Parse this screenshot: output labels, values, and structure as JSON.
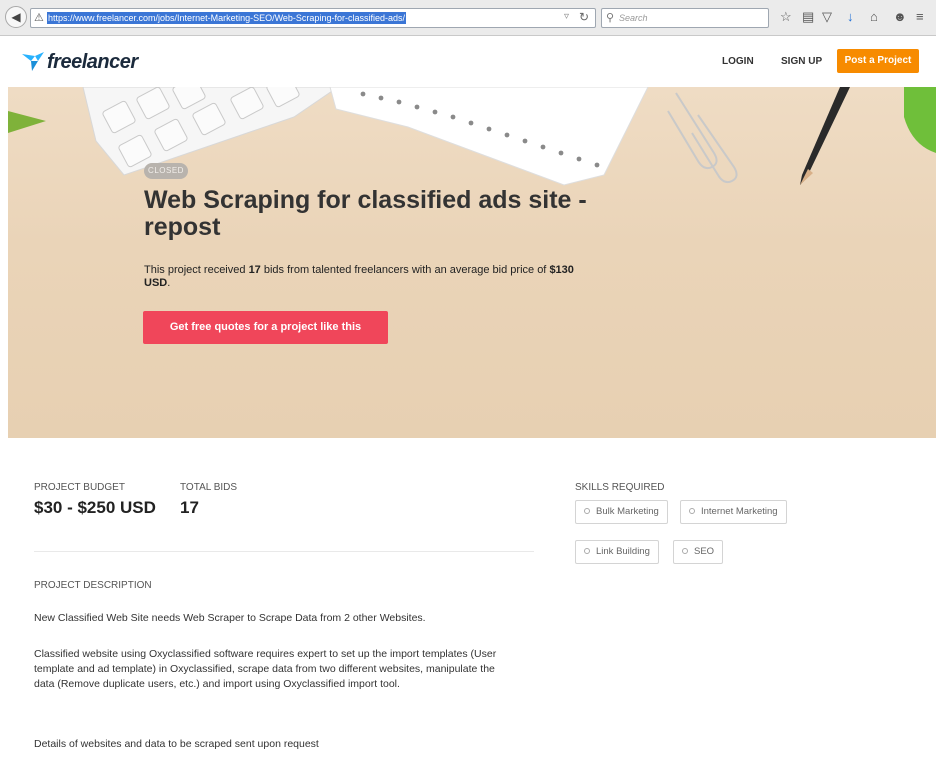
{
  "browser": {
    "url": "https://www.freelancer.com/jobs/Internet-Marketing-SEO/Web-Scraping-for-classified-ads/",
    "search_placeholder": "Search"
  },
  "header": {
    "logo_text": "freelancer",
    "login": "LOGIN",
    "signup": "SIGN UP",
    "post_project": "Post a Project"
  },
  "hero": {
    "badge": "CLOSED",
    "title": "Web Scraping for classified ads site - repost",
    "sub_prefix": "This project received",
    "bids": "17",
    "sub_middle": "bids from talented freelancers with an average bid price of",
    "avg_price": "$130 USD",
    "sub_suffix": ".",
    "cta": "Get free quotes for a project like this"
  },
  "details": {
    "budget_label": "PROJECT BUDGET",
    "budget_value": "$30 - $250 USD",
    "bids_label": "TOTAL BIDS",
    "bids_value": "17",
    "skills_label": "SKILLS REQUIRED",
    "skills": [
      "Bulk Marketing",
      "Internet Marketing",
      "Link Building",
      "SEO"
    ],
    "description_label": "PROJECT DESCRIPTION",
    "description": [
      "New Classified Web Site needs Web Scraper to Scrape Data from 2 other Websites.",
      "Classified website using Oxyclassified software requires expert to set up the import templates (User template and ad template) in Oxyclassified, scrape data from two different websites, manipulate the data (Remove duplicate users, etc.) and import using Oxyclassified import tool.",
      "Details of websites and data to be scraped sent upon request"
    ]
  },
  "colors": {
    "cta": "#f0465a",
    "post_button": "#f78b00",
    "logo_bird": "#29b2fe"
  }
}
